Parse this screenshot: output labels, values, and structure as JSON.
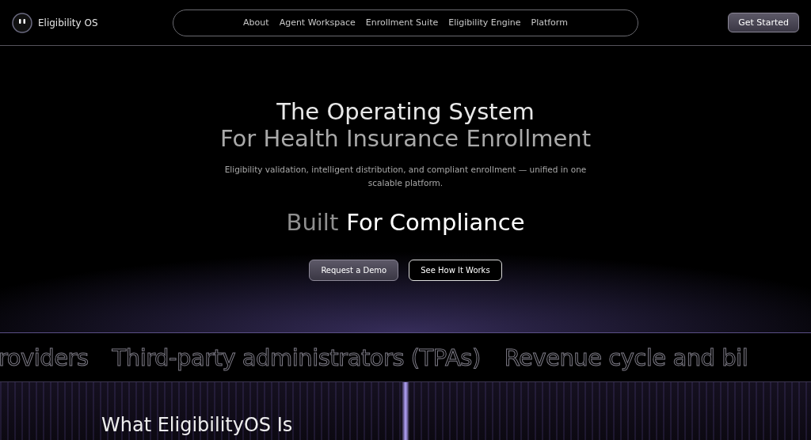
{
  "header": {
    "logo_text": "Eligibility OS",
    "nav": [
      "About",
      "Agent Workspace",
      "Enrollment Suite",
      "Eligibility Engine",
      "Platform"
    ],
    "cta": "Get Started"
  },
  "hero": {
    "title_line_1": "The Operating System",
    "title_line_2": "For Health Insurance Enrollment",
    "subtitle": "Eligibility validation, intelligent distribution, and compliant enrollment — unified in one scalable platform.",
    "tagline_muted": "Built",
    "tagline_bright": "For Compliance",
    "buttons": [
      {
        "label": "Request a Demo",
        "kind": "primary"
      },
      {
        "label": "See How It Works",
        "kind": "outline"
      }
    ]
  },
  "marquee": [
    "roviders",
    "Third-party administrators (TPAs)",
    "Revenue cycle and bil"
  ],
  "section": {
    "heading": "What EligibilityOS Is"
  }
}
